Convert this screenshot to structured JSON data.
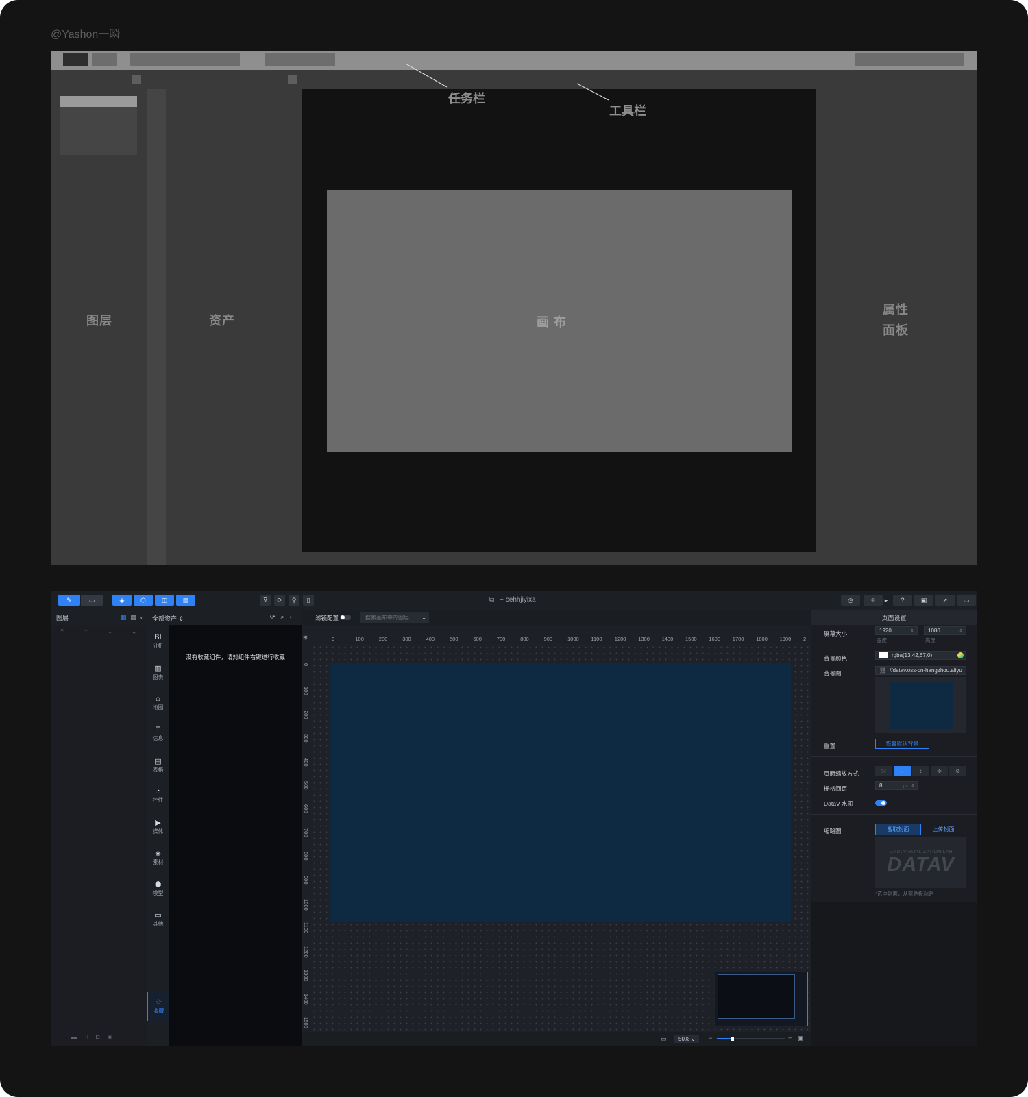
{
  "watermark": "@Yashon一瞬",
  "wireframe": {
    "annotations": {
      "taskbar": "任务栏",
      "toolbar": "工具栏"
    },
    "labels": {
      "layers": "图层",
      "assets": "资产",
      "canvas": "画 布",
      "props_line1": "属性",
      "props_line2": "面板"
    }
  },
  "editor": {
    "title": "~ cehhjiyixa",
    "layers_panel": {
      "title": "图层"
    },
    "assets_panel": {
      "title": "全部资产",
      "empty_text": "没有收藏组件，请对组件右键进行收藏",
      "categories": [
        {
          "icon": "BI",
          "label": "分析"
        },
        {
          "icon": "▥",
          "label": "图表"
        },
        {
          "icon": "⌂",
          "label": "地图"
        },
        {
          "icon": "T",
          "label": "信息"
        },
        {
          "icon": "▤",
          "label": "表格"
        },
        {
          "icon": "◔",
          "label": "控件"
        },
        {
          "icon": "▶",
          "label": "媒体"
        },
        {
          "icon": "◈",
          "label": "素材"
        },
        {
          "icon": "⬢",
          "label": "模型"
        },
        {
          "icon": "▭",
          "label": "其他"
        }
      ],
      "favorites": {
        "icon": "☆",
        "label": "收藏"
      }
    },
    "canvas_bar": {
      "filter_label": "滤镜配置",
      "search_placeholder": "搜索画布中的图层"
    },
    "ruler_h": [
      "0",
      "100",
      "200",
      "300",
      "400",
      "500",
      "600",
      "700",
      "800",
      "900",
      "1000",
      "1100",
      "1200",
      "1300",
      "1400",
      "1500",
      "1600",
      "1700",
      "1800",
      "1900",
      "2"
    ],
    "ruler_v": [
      "0",
      "100",
      "200",
      "300",
      "400",
      "500",
      "600",
      "700",
      "800",
      "900",
      "1000",
      "1100",
      "1200",
      "1300",
      "1400",
      "1500"
    ],
    "zoom": "50%",
    "props": {
      "title": "页面设置",
      "screen_size_label": "屏幕大小",
      "width_value": "1920",
      "height_value": "1080",
      "width_caption": "宽度",
      "height_caption": "高度",
      "bg_color_label": "背景颜色",
      "bg_color_value": "rgba(13,42,67,0)",
      "bg_image_label": "背景图",
      "bg_image_value": "//datav.oss-cn-hangzhou.aliyu",
      "reset_label": "重置",
      "reset_button": "恢复默认背景",
      "zoom_mode_label": "页面缩放方式",
      "grid_label": "栅格间距",
      "grid_value": "8",
      "grid_unit": "px",
      "watermark_label": "DataV 水印",
      "thumb_label": "缩略图",
      "capture_button": "截取封面",
      "upload_button": "上传封面",
      "thumb_caption": "DATA VISUALIZATION LAB",
      "logo_text": "DATAV",
      "thumb_hint": "*选中封面，从剪贴板粘贴"
    },
    "colors": {
      "accent": "#2e82f5",
      "canvas": "#0e2a43"
    }
  }
}
